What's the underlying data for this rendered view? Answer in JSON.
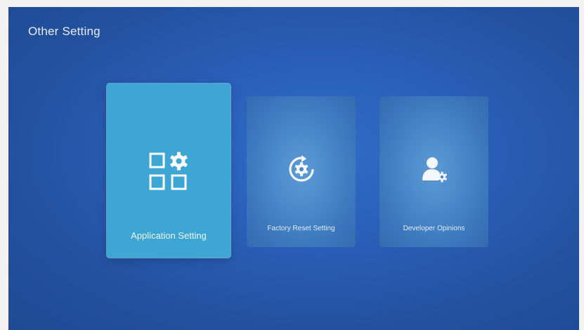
{
  "screen": {
    "title": "Other Setting"
  },
  "tiles": [
    {
      "label": "Application Setting",
      "icon": "apps-gear-icon",
      "selected": true
    },
    {
      "label": "Factory Reset Setting",
      "icon": "reset-gear-icon",
      "selected": false
    },
    {
      "label": "Developer Opinions",
      "icon": "developer-user-icon",
      "selected": false
    }
  ],
  "colors": {
    "background": "#2a5fb8",
    "selected_tile": "#3ea6d4",
    "tile": "#4b8acb",
    "text": "#eef5fb"
  }
}
